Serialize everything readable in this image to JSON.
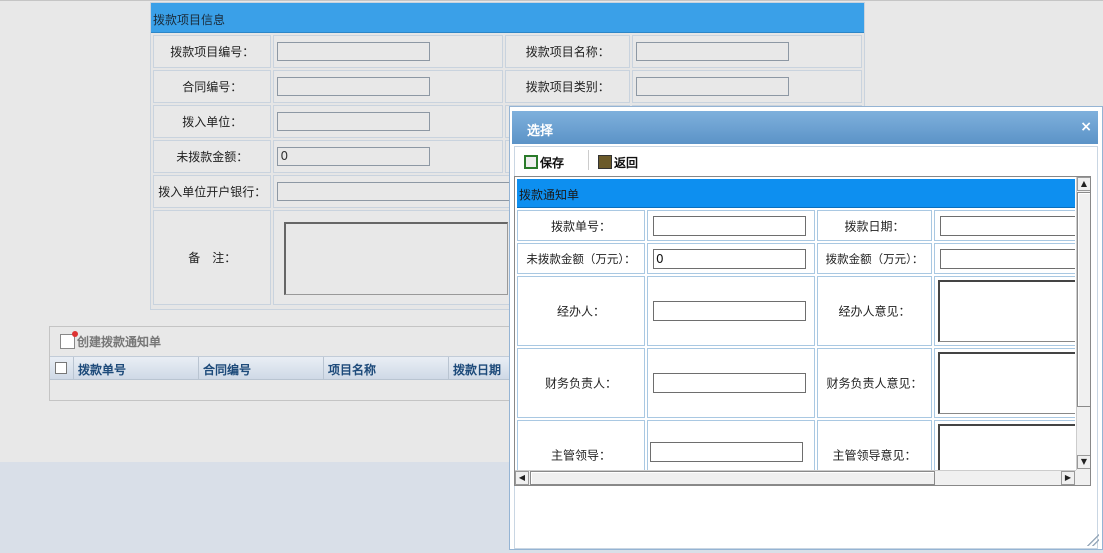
{
  "main_form": {
    "header": "拨款项目信息",
    "labels": {
      "project_no": "拨款项目编号：",
      "project_name": "拨款项目名称：",
      "contract_no": "合同编号：",
      "project_type": "拨款项目类别：",
      "receiver_unit": "拨入单位：",
      "unpaid_amount": "未拨款金额：",
      "receiver_bank": "拨入单位开户银行：",
      "remark": "备　注："
    },
    "values": {
      "unpaid_amount": "0"
    }
  },
  "grid": {
    "toolbar_label": "创建拨款通知单",
    "columns": [
      "拨款单号",
      "合同编号",
      "项目名称",
      "拨款日期"
    ]
  },
  "dialog": {
    "title": "选择",
    "close_symbol": "×",
    "toolbar": {
      "save_label": "保存",
      "back_label": "返回"
    },
    "notice_header": "拨款通知单",
    "labels": {
      "notice_no": "拨款单号：",
      "notice_date": "拨款日期：",
      "unpaid_amount": "未拨款金额（万元）：",
      "amount": "拨款金额（万元）：",
      "handler": "经办人：",
      "handler_opinion": "经办人意见：",
      "finance_head": "财务负责人：",
      "finance_opinion": "财务负责人意见：",
      "supervisor": "主管领导：",
      "supervisor_opinion": "主管领导意见："
    },
    "values": {
      "unpaid_amount": "0"
    }
  }
}
